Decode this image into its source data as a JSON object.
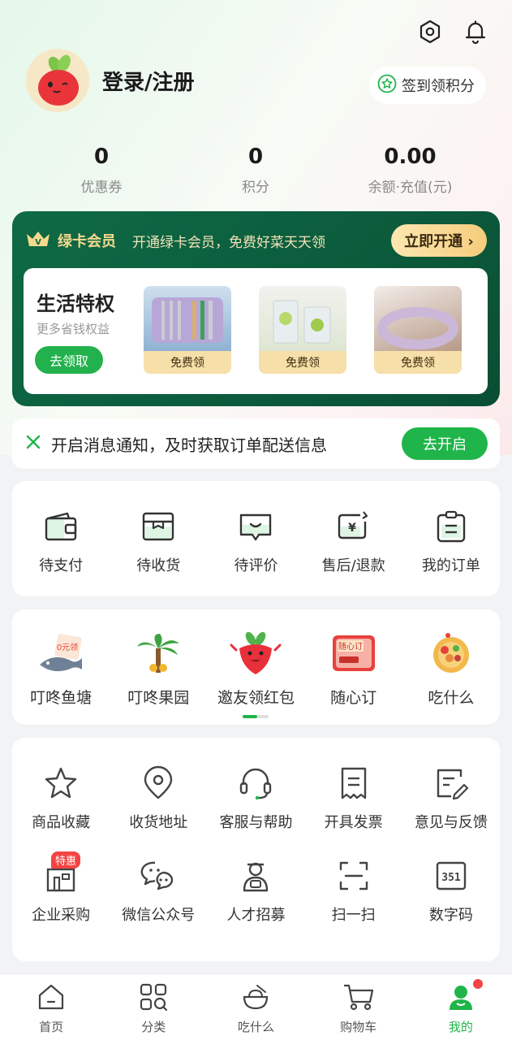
{
  "header": {
    "settings_icon": "settings-hex-icon",
    "bell_icon": "bell-icon"
  },
  "profile": {
    "login_label": "登录/注册",
    "signin_label": "签到领积分"
  },
  "stats": [
    {
      "value": "0",
      "label": "优惠券"
    },
    {
      "value": "0",
      "label": "积分"
    },
    {
      "value": "0.00",
      "label": "余额·充值(元)"
    }
  ],
  "vip": {
    "title": "绿卡会员",
    "desc": "开通绿卡会员，免费好菜天天领",
    "open_label": "立即开通 ›",
    "life_title": "生活特权",
    "life_sub": "更多省钱权益",
    "life_btn": "去领取",
    "perks": [
      {
        "tag": "免费领"
      },
      {
        "tag": "免费领"
      },
      {
        "tag": "免费领"
      }
    ]
  },
  "notify": {
    "text": "开启消息通知，及时获取订单配送信息",
    "button": "去开启"
  },
  "orders": [
    {
      "label": "待支付",
      "icon": "wallet-icon"
    },
    {
      "label": "待收货",
      "icon": "box-icon"
    },
    {
      "label": "待评价",
      "icon": "comment-icon"
    },
    {
      "label": "售后/退款",
      "icon": "refund-icon"
    },
    {
      "label": "我的订单",
      "icon": "order-list-icon"
    }
  ],
  "promos": [
    {
      "label": "叮咚鱼塘",
      "icon": "fish-pond-icon"
    },
    {
      "label": "叮咚果园",
      "icon": "orchard-icon"
    },
    {
      "label": "邀友领红包",
      "icon": "radish-mascot-icon"
    },
    {
      "label": "随心订",
      "icon": "subscription-card-icon"
    },
    {
      "label": "吃什么",
      "icon": "food-bowl-icon"
    }
  ],
  "services_row1": [
    {
      "label": "商品收藏",
      "icon": "star-icon"
    },
    {
      "label": "收货地址",
      "icon": "location-icon"
    },
    {
      "label": "客服与帮助",
      "icon": "headset-icon"
    },
    {
      "label": "开具发票",
      "icon": "invoice-icon"
    },
    {
      "label": "意见与反馈",
      "icon": "feedback-icon"
    }
  ],
  "services_row2": [
    {
      "label": "企业采购",
      "icon": "enterprise-icon",
      "badge": "特惠"
    },
    {
      "label": "微信公众号",
      "icon": "wechat-icon"
    },
    {
      "label": "人才招募",
      "icon": "recruit-icon"
    },
    {
      "label": "扫一扫",
      "icon": "scan-icon"
    },
    {
      "label": "数字码",
      "icon": "digit-code-icon"
    }
  ],
  "tabbar": [
    {
      "label": "首页",
      "icon": "home-icon"
    },
    {
      "label": "分类",
      "icon": "category-icon"
    },
    {
      "label": "吃什么",
      "icon": "bowl-icon"
    },
    {
      "label": "购物车",
      "icon": "cart-icon"
    },
    {
      "label": "我的",
      "icon": "profile-icon",
      "active": true
    }
  ],
  "colors": {
    "brand_green": "#1fb54a",
    "vip_green": "#0e6a45",
    "gold": "#f6cc7c",
    "badge_red": "#f44343"
  }
}
